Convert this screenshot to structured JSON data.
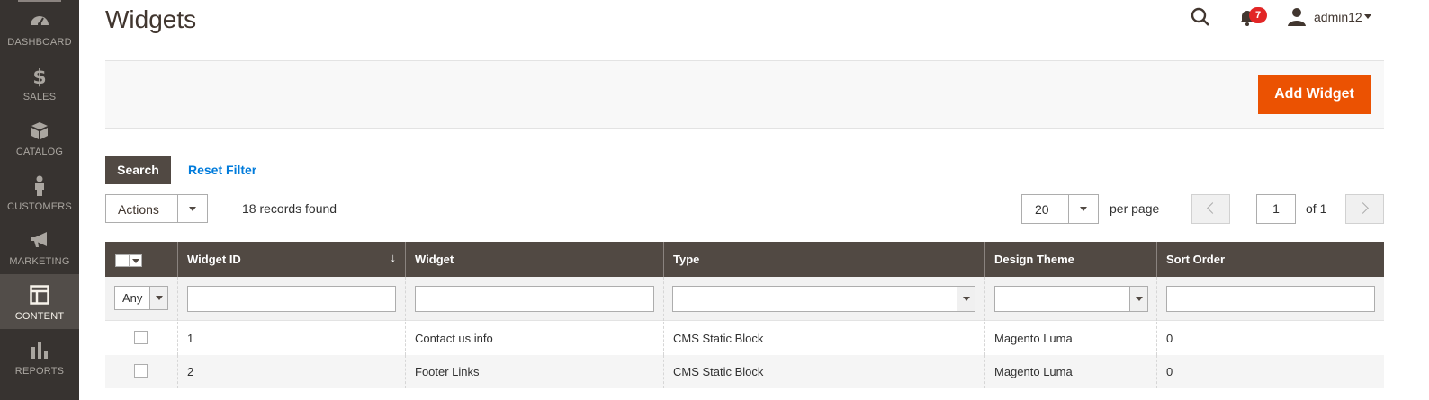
{
  "sidebar": {
    "items": [
      {
        "label": "DASHBOARD",
        "icon": "dashboard-icon"
      },
      {
        "label": "SALES",
        "icon": "dollar-icon"
      },
      {
        "label": "CATALOG",
        "icon": "box-icon"
      },
      {
        "label": "CUSTOMERS",
        "icon": "person-icon"
      },
      {
        "label": "MARKETING",
        "icon": "megaphone-icon"
      },
      {
        "label": "CONTENT",
        "icon": "layout-icon"
      },
      {
        "label": "REPORTS",
        "icon": "bar-chart-icon"
      }
    ],
    "active": "CONTENT"
  },
  "header": {
    "title": "Widgets",
    "notifications_count": "7",
    "user_name": "admin12"
  },
  "action_bar": {
    "add_label": "Add Widget"
  },
  "filters": {
    "search_label": "Search",
    "reset_label": "Reset Filter"
  },
  "toolbar": {
    "actions_label": "Actions",
    "records_text": "18 records found",
    "per_page_value": "20",
    "per_page_label": "per page",
    "page_value": "1",
    "page_of": "of 1"
  },
  "grid": {
    "columns": [
      "Widget ID",
      "Widget",
      "Type",
      "Design Theme",
      "Sort Order"
    ],
    "mass_filter_value": "Any",
    "rows": [
      {
        "id": "1",
        "widget": "Contact us info",
        "type": "CMS Static Block",
        "theme": "Magento Luma",
        "sort": "0"
      },
      {
        "id": "2",
        "widget": "Footer Links",
        "type": "CMS Static Block",
        "theme": "Magento Luma",
        "sort": "0"
      }
    ]
  },
  "colors": {
    "sidebar_bg": "#373330",
    "sidebar_active": "#524d49",
    "primary_button": "#eb5202",
    "grid_header": "#514943",
    "link": "#007bdb",
    "badge": "#e22626"
  }
}
